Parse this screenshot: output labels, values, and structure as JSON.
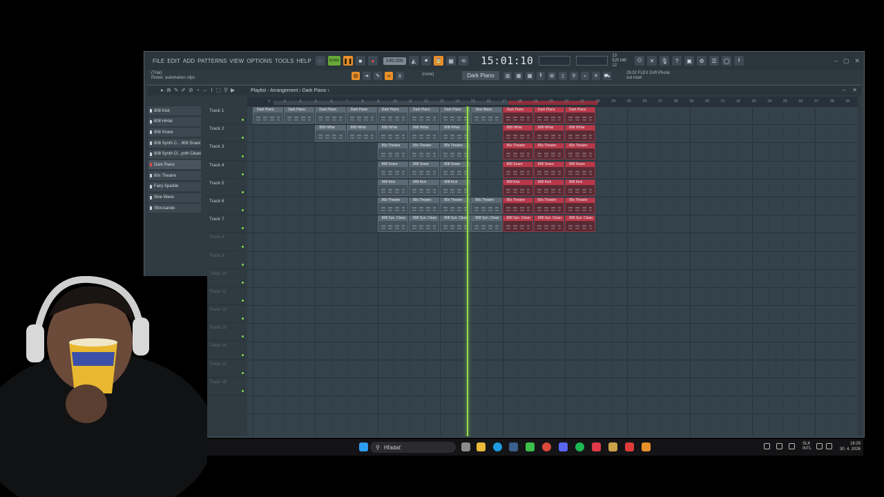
{
  "menu": [
    "FILE",
    "EDIT",
    "ADD",
    "PATTERNS",
    "VIEW",
    "OPTIONS",
    "TOOLS",
    "HELP"
  ],
  "toolbar": {
    "time": "15:01:10",
    "bpm": "140.000",
    "cpu_line1": "525 MB",
    "cpu_line2": "12",
    "cpu_num": "13",
    "song_pat": "SONG"
  },
  "hint": {
    "line1": "(Trial)",
    "line2": "Picker: automation clips"
  },
  "pattern_selector": "Dark Piano",
  "none_selector": "(none)",
  "news": {
    "line1": "29.02   FLEX Drift Phonk",
    "line2": "out now!"
  },
  "playlist": {
    "title": "Playlist - Arrangement › Dark Piano ›"
  },
  "picker": [
    {
      "label": "808 Kick",
      "sel": false,
      "red": false
    },
    {
      "label": "808 HiHat",
      "sel": false,
      "red": false
    },
    {
      "label": "808 Snare",
      "sel": false,
      "red": false
    },
    {
      "label": "808 Synth C... 808 Snare",
      "sel": false,
      "red": false
    },
    {
      "label": "808 Synth Cl...ynth Clean",
      "sel": false,
      "red": false
    },
    {
      "label": "Dark Piano",
      "sel": true,
      "red": true
    },
    {
      "label": "80s Theatre",
      "sel": false,
      "red": false
    },
    {
      "label": "Fairy Sparkle",
      "sel": false,
      "red": false
    },
    {
      "label": "Sine Wave",
      "sel": false,
      "red": false
    },
    {
      "label": "Sforzsando",
      "sel": false,
      "red": false
    }
  ],
  "tracks": [
    "Track 1",
    "Track 2",
    "Track 3",
    "Track 4",
    "Track 5",
    "Track 6",
    "Track 7",
    "Track 8",
    "Track 9",
    "Track 10",
    "Track 11",
    "Track 12",
    "Track 13",
    "Track 14",
    "Track 15",
    "Track 16"
  ],
  "ruler": [
    "2",
    "3",
    "4",
    "5",
    "6",
    "7",
    "8",
    "9",
    "10",
    "11",
    "12",
    "13",
    "14",
    "15",
    "16",
    "17",
    "18",
    "19",
    "20",
    "21",
    "22",
    "23",
    "24",
    "25",
    "26",
    "27",
    "28",
    "29",
    "30",
    "31",
    "32",
    "33",
    "34",
    "35",
    "36",
    "37",
    "38",
    "39"
  ],
  "clips": [
    {
      "track": 0,
      "start": 0,
      "len": 2,
      "label": "Dark Piano",
      "red": false
    },
    {
      "track": 0,
      "start": 2,
      "len": 2,
      "label": "Dark Piano",
      "red": false
    },
    {
      "track": 0,
      "start": 4,
      "len": 2,
      "label": "Dark Piano",
      "red": false
    },
    {
      "track": 0,
      "start": 6,
      "len": 2,
      "label": "Dark Piano",
      "red": false
    },
    {
      "track": 0,
      "start": 8,
      "len": 2,
      "label": "Dark Piano",
      "red": false
    },
    {
      "track": 0,
      "start": 10,
      "len": 2,
      "label": "Dark Piano",
      "red": false
    },
    {
      "track": 0,
      "start": 12,
      "len": 2,
      "label": "Dark Piano",
      "red": false
    },
    {
      "track": 0,
      "start": 14,
      "len": 2,
      "label": "Sine Wave",
      "red": false
    },
    {
      "track": 0,
      "start": 16,
      "len": 2,
      "label": "Dark Piano",
      "red": true
    },
    {
      "track": 0,
      "start": 18,
      "len": 2,
      "label": "Dark Piano",
      "red": true
    },
    {
      "track": 0,
      "start": 20,
      "len": 2,
      "label": "Dark Piano",
      "red": true
    },
    {
      "track": 1,
      "start": 4,
      "len": 2,
      "label": "808 HiHat",
      "red": false
    },
    {
      "track": 1,
      "start": 6,
      "len": 2,
      "label": "808 HiHat",
      "red": false
    },
    {
      "track": 1,
      "start": 8,
      "len": 2,
      "label": "808 HiHat",
      "red": false
    },
    {
      "track": 1,
      "start": 10,
      "len": 2,
      "label": "808 HiHat",
      "red": false
    },
    {
      "track": 1,
      "start": 12,
      "len": 2,
      "label": "808 HiHat",
      "red": false
    },
    {
      "track": 1,
      "start": 16,
      "len": 2,
      "label": "808 HiHat",
      "red": true
    },
    {
      "track": 1,
      "start": 18,
      "len": 2,
      "label": "808 HiHat",
      "red": true
    },
    {
      "track": 1,
      "start": 20,
      "len": 2,
      "label": "808 HiHat",
      "red": true
    },
    {
      "track": 2,
      "start": 8,
      "len": 2,
      "label": "80s Theatre",
      "red": false
    },
    {
      "track": 2,
      "start": 10,
      "len": 2,
      "label": "80s Theatre",
      "red": false
    },
    {
      "track": 2,
      "start": 12,
      "len": 2,
      "label": "80s Theatre",
      "red": false
    },
    {
      "track": 2,
      "start": 16,
      "len": 2,
      "label": "80s Theatre",
      "red": true
    },
    {
      "track": 2,
      "start": 18,
      "len": 2,
      "label": "80s Theatre",
      "red": true
    },
    {
      "track": 2,
      "start": 20,
      "len": 2,
      "label": "80s Theatre",
      "red": true
    },
    {
      "track": 3,
      "start": 8,
      "len": 2,
      "label": "808 Snare",
      "red": false
    },
    {
      "track": 3,
      "start": 10,
      "len": 2,
      "label": "808 Snare",
      "red": false
    },
    {
      "track": 3,
      "start": 12,
      "len": 2,
      "label": "808 Snare",
      "red": false
    },
    {
      "track": 3,
      "start": 16,
      "len": 2,
      "label": "808 Snare",
      "red": true
    },
    {
      "track": 3,
      "start": 18,
      "len": 2,
      "label": "808 Snare",
      "red": true
    },
    {
      "track": 3,
      "start": 20,
      "len": 2,
      "label": "808 Snare",
      "red": true
    },
    {
      "track": 4,
      "start": 8,
      "len": 2,
      "label": "808 Kick",
      "red": false
    },
    {
      "track": 4,
      "start": 10,
      "len": 2,
      "label": "808 Kick",
      "red": false
    },
    {
      "track": 4,
      "start": 12,
      "len": 2,
      "label": "808 Kick",
      "red": false
    },
    {
      "track": 4,
      "start": 16,
      "len": 2,
      "label": "808 Kick",
      "red": true
    },
    {
      "track": 4,
      "start": 18,
      "len": 2,
      "label": "808 Kick",
      "red": true
    },
    {
      "track": 4,
      "start": 20,
      "len": 2,
      "label": "808 Kick",
      "red": true
    },
    {
      "track": 5,
      "start": 8,
      "len": 2,
      "label": "80s Theatre",
      "red": false
    },
    {
      "track": 5,
      "start": 10,
      "len": 2,
      "label": "80s Theatre",
      "red": false
    },
    {
      "track": 5,
      "start": 12,
      "len": 2,
      "label": "80s Theatre",
      "red": false
    },
    {
      "track": 5,
      "start": 14,
      "len": 2,
      "label": "80s Theatre",
      "red": false
    },
    {
      "track": 5,
      "start": 16,
      "len": 2,
      "label": "80s Theatre",
      "red": true
    },
    {
      "track": 5,
      "start": 18,
      "len": 2,
      "label": "80s Theatre",
      "red": true
    },
    {
      "track": 5,
      "start": 20,
      "len": 2,
      "label": "80s Theatre",
      "red": true
    },
    {
      "track": 6,
      "start": 8,
      "len": 2,
      "label": "808 Syn. Clean",
      "red": false
    },
    {
      "track": 6,
      "start": 10,
      "len": 2,
      "label": "808 Syn. Clean",
      "red": false
    },
    {
      "track": 6,
      "start": 12,
      "len": 2,
      "label": "808 Syn. Clean",
      "red": false
    },
    {
      "track": 6,
      "start": 14,
      "len": 2,
      "label": "808 Syn. Clean",
      "red": false
    },
    {
      "track": 6,
      "start": 16,
      "len": 2,
      "label": "808 Syn. Clean",
      "red": true
    },
    {
      "track": 6,
      "start": 18,
      "len": 2,
      "label": "808 Syn. Clean",
      "red": true
    },
    {
      "track": 6,
      "start": 20,
      "len": 2,
      "label": "808 Syn. Clean",
      "red": true
    }
  ],
  "taskbar": {
    "search": "Hľadať",
    "lang_line1": "SLK",
    "lang_line2": "INTL",
    "time": "18:29",
    "date": "30. 4. 2026"
  },
  "colors": {
    "accent": "#e8902a",
    "clip_red": "#b8394a",
    "playhead": "#9ae04a"
  }
}
